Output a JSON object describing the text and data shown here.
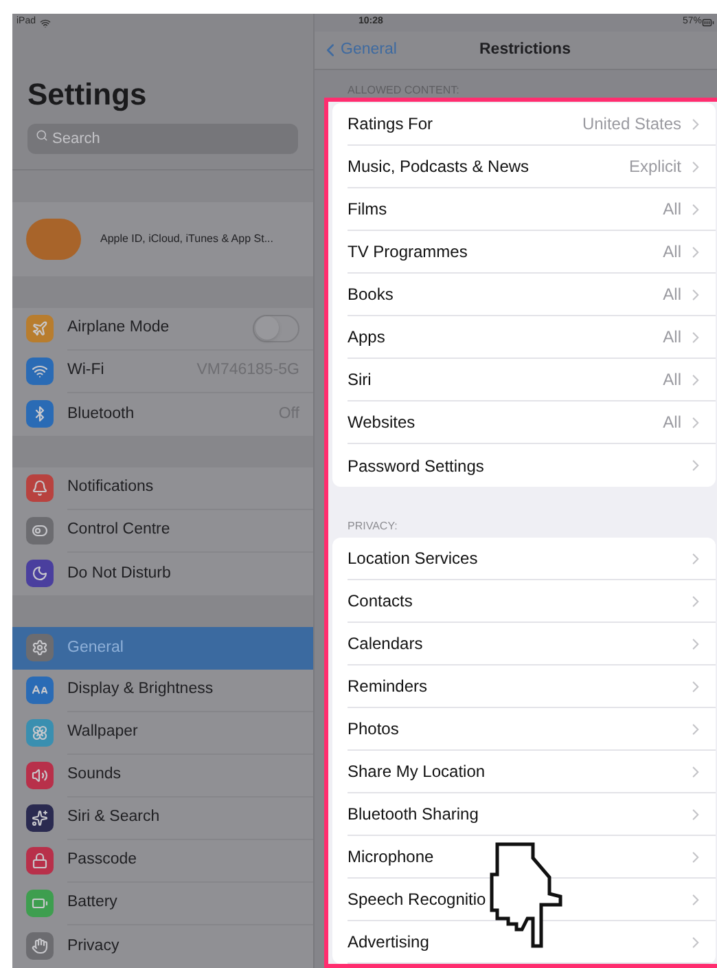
{
  "status_bar": {
    "device": "iPad",
    "time": "10:28",
    "battery": "57%"
  },
  "sidebar": {
    "title": "Settings",
    "search": {
      "placeholder": "Search"
    },
    "account": {
      "label": "Apple ID, iCloud, iTunes & App St..."
    },
    "groups": [
      [
        {
          "kind": "toggle",
          "label": "Airplane Mode",
          "color": "#b87d2e",
          "on": false,
          "selected": false
        },
        {
          "kind": "value",
          "label": "Wi-Fi",
          "value": "VM746185-5G",
          "color": "#2a6bb5",
          "selected": false
        },
        {
          "kind": "value",
          "label": "Bluetooth",
          "value": "Off",
          "color": "#2a6bb5",
          "selected": false
        }
      ],
      [
        {
          "kind": "plain",
          "label": "Notifications",
          "color": "#b8423f",
          "selected": false
        },
        {
          "kind": "plain",
          "label": "Control Centre",
          "color": "#6c6c70",
          "selected": false
        },
        {
          "kind": "plain",
          "label": "Do Not Disturb",
          "color": "#4a3f9e",
          "selected": false
        }
      ],
      [
        {
          "kind": "plain",
          "label": "General",
          "color": "#6c6c70",
          "selected": true
        },
        {
          "kind": "plain",
          "label": "Display & Brightness",
          "color": "#2a6bb5",
          "selected": false
        },
        {
          "kind": "plain",
          "label": "Wallpaper",
          "color": "#3a8fb0",
          "selected": false
        },
        {
          "kind": "plain",
          "label": "Sounds",
          "color": "#b8304a",
          "selected": false
        },
        {
          "kind": "plain",
          "label": "Siri & Search",
          "color": "#2a2a50",
          "selected": false
        },
        {
          "kind": "plain",
          "label": "Passcode",
          "color": "#b8304a",
          "selected": false
        },
        {
          "kind": "plain",
          "label": "Battery",
          "color": "#3e9e4f",
          "selected": false
        },
        {
          "kind": "plain",
          "label": "Privacy",
          "color": "#6c6c70",
          "selected": false
        }
      ]
    ]
  },
  "detail": {
    "back": "General",
    "title": "Restrictions",
    "sections": [
      {
        "header": "ALLOWED CONTENT:",
        "rows": [
          {
            "label": "Ratings For",
            "value": "United States"
          },
          {
            "label": "Music, Podcasts & News",
            "value": "Explicit"
          },
          {
            "label": "Films",
            "value": "All"
          },
          {
            "label": "TV Programmes",
            "value": "All"
          },
          {
            "label": "Books",
            "value": "All"
          },
          {
            "label": "Apps",
            "value": "All"
          },
          {
            "label": "Siri",
            "value": "All"
          },
          {
            "label": "Websites",
            "value": "All"
          },
          {
            "label": "Password Settings"
          }
        ]
      },
      {
        "header": "PRIVACY:",
        "rows": [
          {
            "label": "Location Services"
          },
          {
            "label": "Contacts"
          },
          {
            "label": "Calendars"
          },
          {
            "label": "Reminders"
          },
          {
            "label": "Photos"
          },
          {
            "label": "Share My Location"
          },
          {
            "label": "Bluetooth Sharing"
          },
          {
            "label": "Microphone"
          },
          {
            "label": "Speech Recognitio"
          },
          {
            "label": "Advertising"
          }
        ]
      }
    ]
  }
}
